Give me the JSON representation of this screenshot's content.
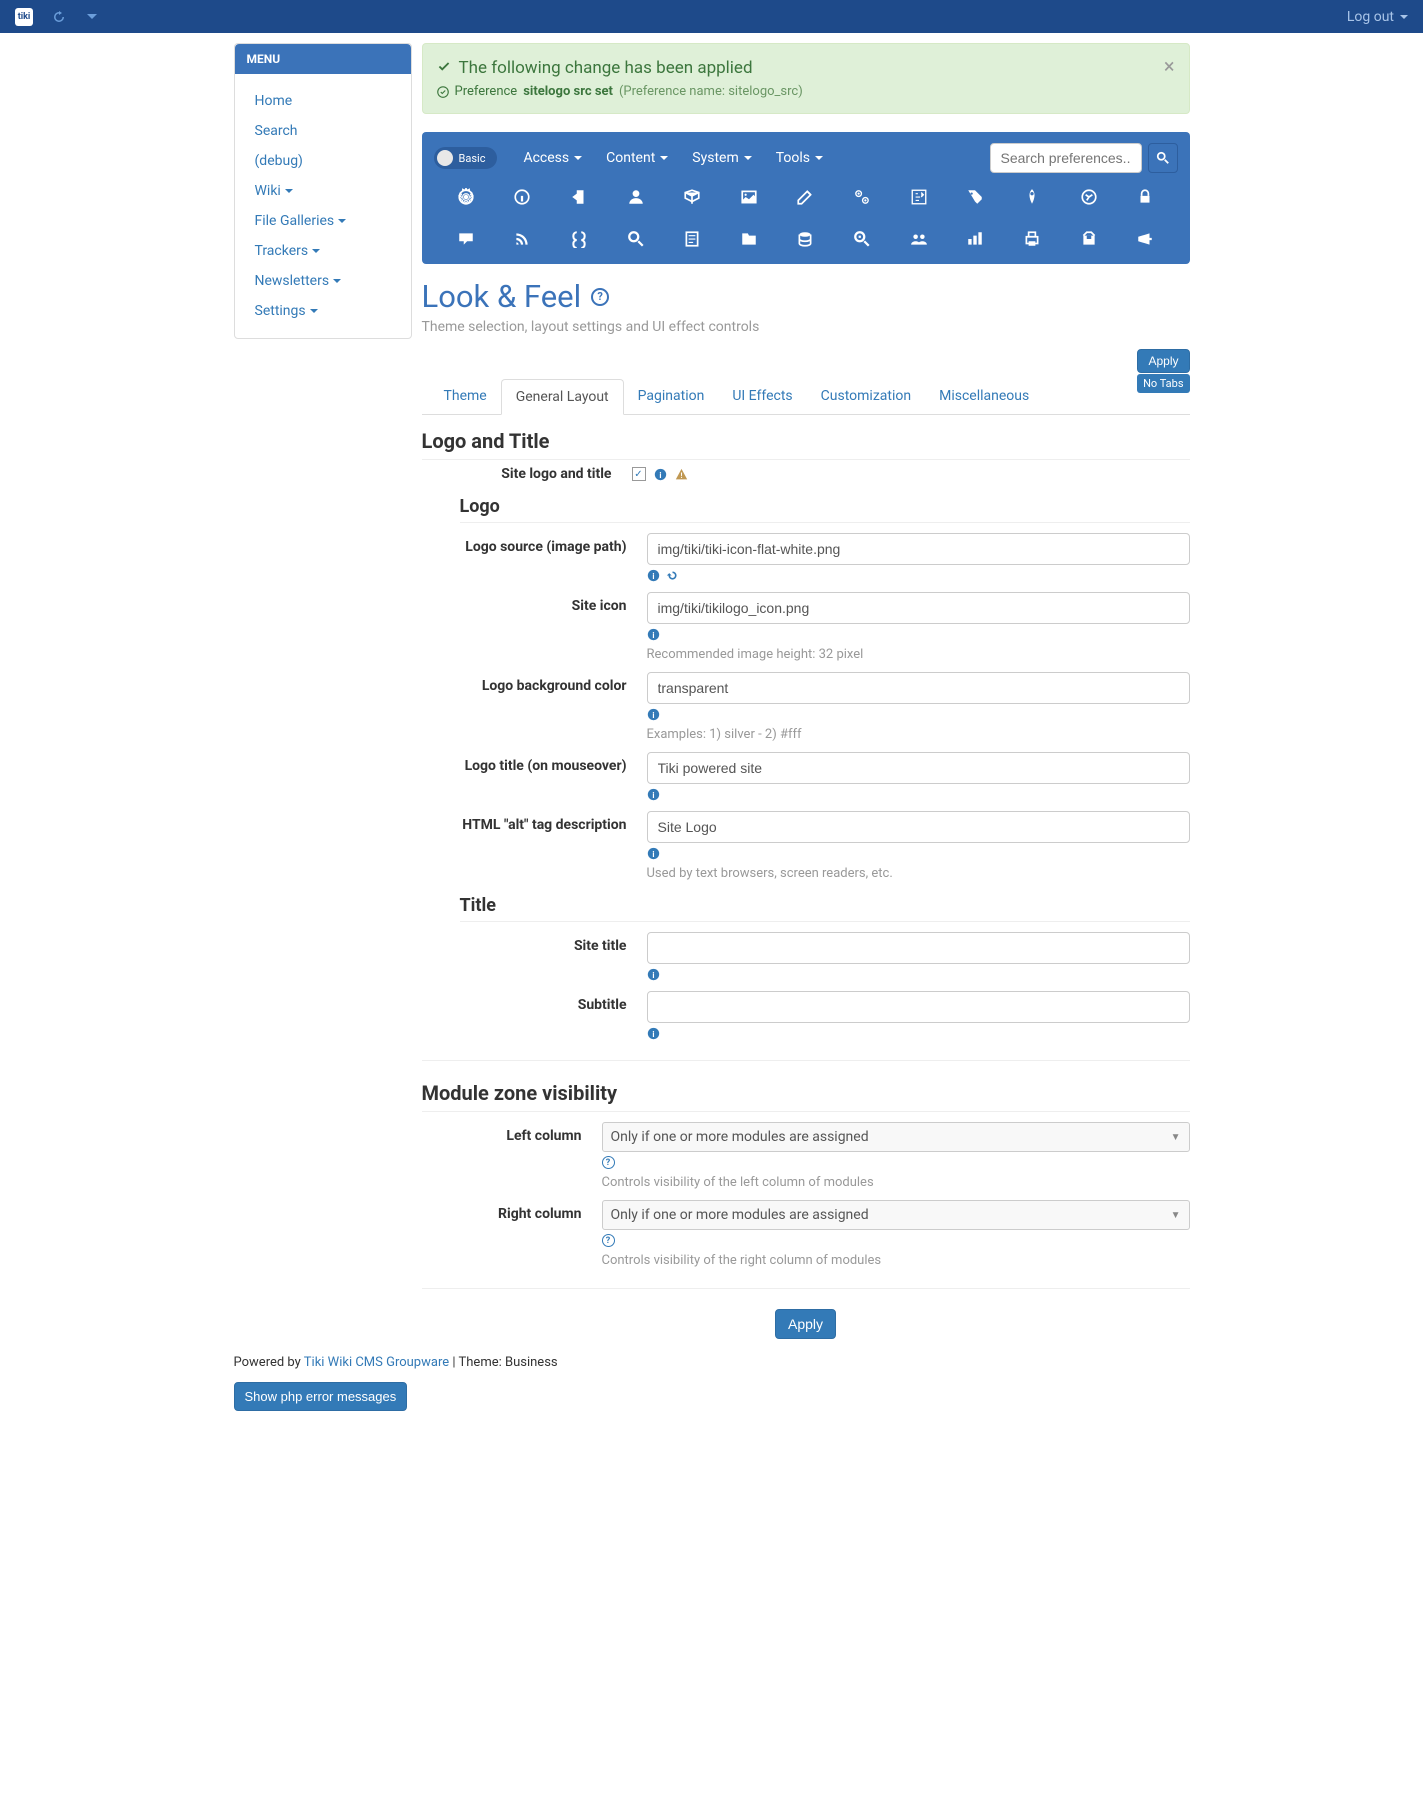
{
  "topbar": {
    "logout": "Log out"
  },
  "sidebar": {
    "heading": "MENU",
    "items": [
      {
        "label": "Home",
        "caret": false
      },
      {
        "label": "Search",
        "caret": false
      },
      {
        "label": "(debug)",
        "caret": false
      },
      {
        "label": "Wiki",
        "caret": true
      },
      {
        "label": "File Galleries",
        "caret": true
      },
      {
        "label": "Trackers",
        "caret": true
      },
      {
        "label": "Newsletters",
        "caret": true
      },
      {
        "label": "Settings",
        "caret": true
      }
    ]
  },
  "alert": {
    "line1": "The following change has been applied",
    "pref_label": "Preference",
    "pref_bold": "sitelogo src set",
    "pref_paren": "(Preference name: sitelogo_src)"
  },
  "navbar": {
    "basic": "Basic",
    "links": [
      "Access",
      "Content",
      "System",
      "Tools"
    ],
    "search_placeholder": "Search preferences..."
  },
  "page": {
    "title": "Look & Feel",
    "desc": "Theme selection, layout settings and UI effect controls",
    "apply": "Apply",
    "notabs": "No Tabs"
  },
  "tabs": [
    "Theme",
    "General Layout",
    "Pagination",
    "UI Effects",
    "Customization",
    "Miscellaneous"
  ],
  "active_tab_index": 1,
  "sections": {
    "logo_title": "Logo and Title",
    "logo_sub": "Logo",
    "title_sub": "Title",
    "module_zone": "Module zone visibility"
  },
  "fields": {
    "site_logo_title": "Site logo and title",
    "logo_source": {
      "label": "Logo source (image path)",
      "value": "img/tiki/tiki-icon-flat-white.png"
    },
    "site_icon": {
      "label": "Site icon",
      "value": "img/tiki/tikilogo_icon.png",
      "help": "Recommended image height: 32 pixel"
    },
    "logo_bg": {
      "label": "Logo background color",
      "value": "transparent",
      "help": "Examples: 1) silver - 2) #fff"
    },
    "logo_title": {
      "label": "Logo title (on mouseover)",
      "value": "Tiki powered site"
    },
    "alt_tag": {
      "label": "HTML \"alt\" tag description",
      "value": "Site Logo",
      "help": "Used by text browsers, screen readers, etc."
    },
    "site_title": {
      "label": "Site title",
      "value": ""
    },
    "subtitle": {
      "label": "Subtitle",
      "value": ""
    },
    "left_col": {
      "label": "Left column",
      "value": "Only if one or more modules are assigned",
      "help": "Controls visibility of the left column of modules"
    },
    "right_col": {
      "label": "Right column",
      "value": "Only if one or more modules are assigned",
      "help": "Controls visibility of the right column of modules"
    }
  },
  "footer": {
    "powered": "Powered by ",
    "link": "Tiki Wiki CMS Groupware",
    "theme": "  | Theme: Business",
    "errbtn": "Show php error messages"
  }
}
